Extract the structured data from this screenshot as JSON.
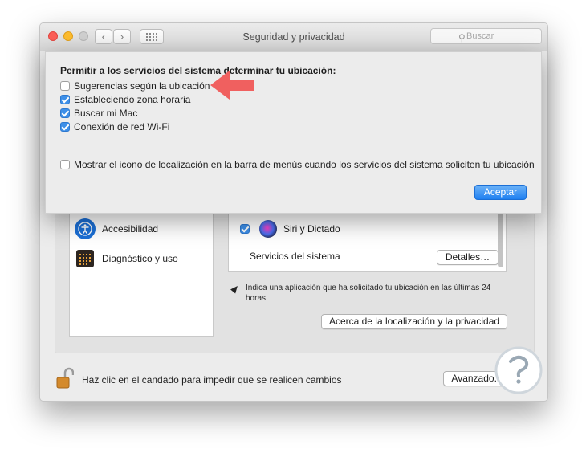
{
  "window": {
    "title": "Seguridad y privacidad",
    "search_placeholder": "Buscar"
  },
  "sidebar": {
    "items": [
      {
        "label": "Accesibilidad",
        "icon": "accessibility-icon"
      },
      {
        "label": "Diagnóstico y uso",
        "icon": "diagnostics-icon"
      }
    ]
  },
  "services_list": {
    "siri_row": {
      "label": "Siri y Dictado",
      "checked": true
    },
    "system_row": {
      "label": "Servicios del sistema",
      "button": "Detalles…"
    }
  },
  "note": "Indica una aplicación que ha solicitado tu ubicación en las últimas 24 horas.",
  "about_button": "Acerca de la localización y la privacidad",
  "footer": {
    "lock_text": "Haz clic en el candado para impedir que se realicen cambios",
    "advanced_button": "Avanzado..."
  },
  "sheet": {
    "title": "Permitir a los servicios del sistema determinar tu ubicación:",
    "options": [
      {
        "label": "Sugerencias según la ubicación",
        "checked": false
      },
      {
        "label": "Estableciendo zona horaria",
        "checked": true
      },
      {
        "label": "Buscar mi Mac",
        "checked": true
      },
      {
        "label": "Conexión de red Wi-Fi",
        "checked": true
      }
    ],
    "menu_icon_option": {
      "label": "Mostrar el icono de localización en la barra de menús cuando los servicios del sistema soliciten tu ubicación",
      "checked": false
    },
    "accept_button": "Aceptar"
  },
  "colors": {
    "accent": "#1f7ff0",
    "annotation_arrow": "#f0605f"
  }
}
